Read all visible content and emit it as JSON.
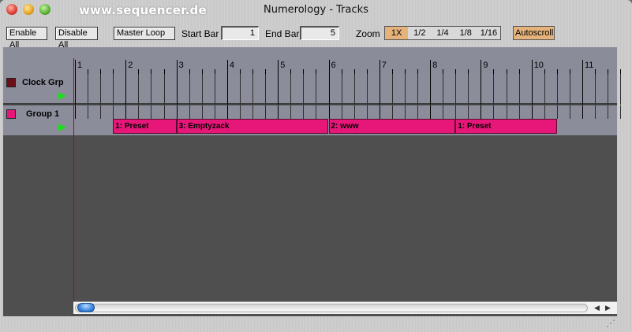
{
  "window": {
    "title": "Numerology - Tracks",
    "watermark": "www.sequencer.de"
  },
  "toolbar": {
    "enable_all": "Enable All",
    "disable_all": "Disable All",
    "master_loop": "Master Loop",
    "start_bar_label": "Start Bar",
    "start_bar_value": "1",
    "end_bar_label": "End Bar",
    "end_bar_value": "5",
    "zoom_label": "Zoom",
    "zoom_options": [
      "1X",
      "1/2",
      "1/4",
      "1/8",
      "1/16"
    ],
    "zoom_selected": "1X",
    "autoscroll": "Autoscroll"
  },
  "ruler": {
    "bars": [
      "1",
      "2",
      "3",
      "4",
      "5",
      "6",
      "7",
      "8",
      "9",
      "10",
      "11"
    ]
  },
  "tracks": [
    {
      "name": "Clock Grp",
      "color": "#6b0f1a",
      "clips": []
    },
    {
      "name": "Group 1",
      "color": "#e7177a",
      "clips": [
        {
          "label": "1: Preset",
          "start_bar": 1.75,
          "end_bar": 3.0
        },
        {
          "label": "3: Emptyzack",
          "start_bar": 3.0,
          "end_bar": 6.0
        },
        {
          "label": "2: www",
          "start_bar": 6.0,
          "end_bar": 8.5
        },
        {
          "label": "1: Preset",
          "start_bar": 8.5,
          "end_bar": 10.5
        }
      ]
    }
  ],
  "icons": {
    "play": "play-icon",
    "scroll_left": "scroll-left-icon",
    "scroll_right": "scroll-right-icon",
    "resize_grip": "resize-grip-icon"
  },
  "colors": {
    "clip": "#e7177a",
    "zoom_active": "#e4b27a",
    "play_arrow": "#16e316",
    "playhead": "#c00000"
  }
}
